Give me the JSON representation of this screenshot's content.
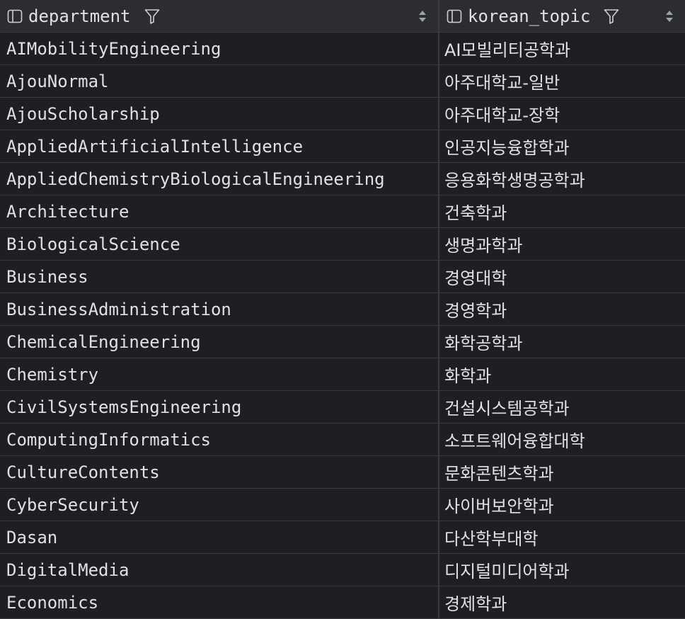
{
  "columns": [
    {
      "name": "department"
    },
    {
      "name": "korean_topic"
    }
  ],
  "rows": [
    [
      "AIMobilityEngineering",
      "AI모빌리티공학과"
    ],
    [
      "AjouNormal",
      "아주대학교-일반"
    ],
    [
      "AjouScholarship",
      "아주대학교-장학"
    ],
    [
      "AppliedArtificialIntelligence",
      "인공지능융합학과"
    ],
    [
      "AppliedChemistryBiologicalEngineering",
      "응용화학생명공학과"
    ],
    [
      "Architecture",
      "건축학과"
    ],
    [
      "BiologicalScience",
      "생명과학과"
    ],
    [
      "Business",
      "경영대학"
    ],
    [
      "BusinessAdministration",
      "경영학과"
    ],
    [
      "ChemicalEngineering",
      "화학공학과"
    ],
    [
      "Chemistry",
      "화학과"
    ],
    [
      "CivilSystemsEngineering",
      "건설시스템공학과"
    ],
    [
      "ComputingInformatics",
      "소프트웨어융합대학"
    ],
    [
      "CultureContents",
      "문화콘텐츠학과"
    ],
    [
      "CyberSecurity",
      "사이버보안학과"
    ],
    [
      "Dasan",
      "다산학부대학"
    ],
    [
      "DigitalMedia",
      "디지털미디어학과"
    ],
    [
      "Economics",
      "경제학과"
    ]
  ],
  "icons": {
    "column": "column-icon",
    "filter": "filter-icon",
    "sort": "sort-icon"
  },
  "colors": {
    "background": "#1e1f22",
    "header": "#2b2d30",
    "grid_line": "#393b40",
    "text": "#dfe1e5"
  }
}
